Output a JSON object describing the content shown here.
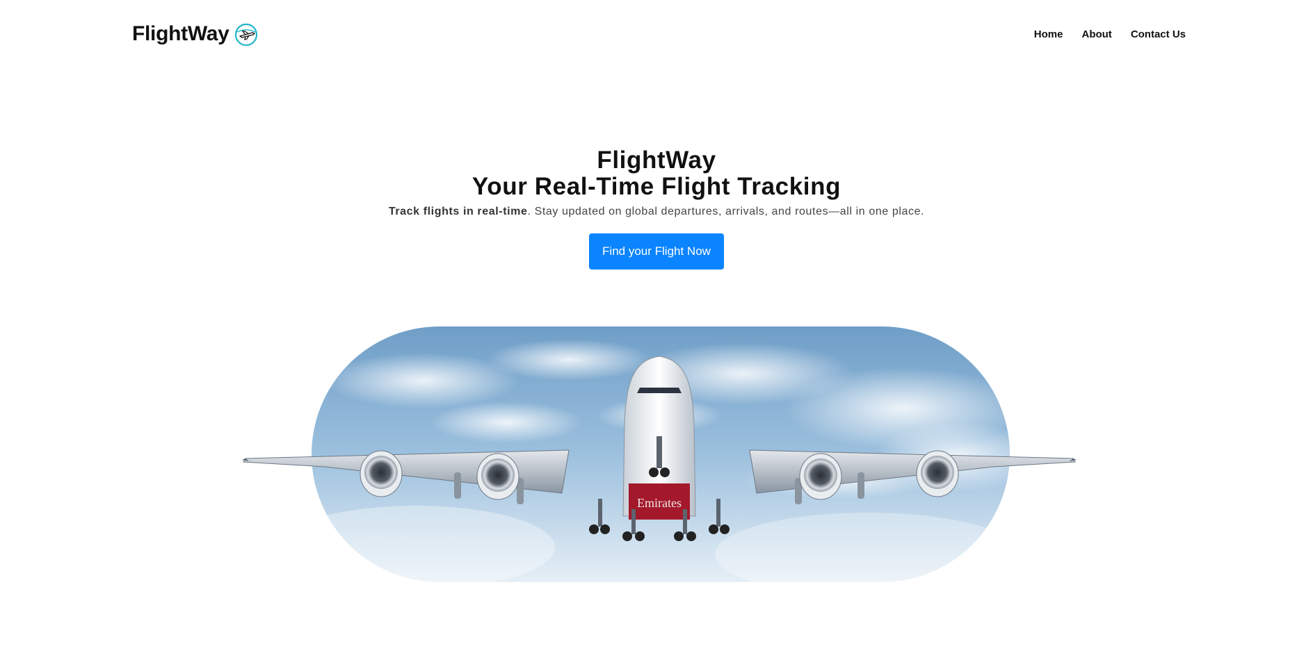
{
  "header": {
    "logo_text": "FlightWay",
    "logo_icon": "plane-globe-icon",
    "nav": [
      {
        "label": "Home"
      },
      {
        "label": "About"
      },
      {
        "label": "Contact Us"
      }
    ]
  },
  "hero": {
    "title_line1": "FlightWay",
    "title_line2": "Your Real-Time Flight Tracking",
    "subtitle_bold": "Track flights in real-time",
    "subtitle_rest": ". Stay updated on global departures, arrivals, and routes—all in one place.",
    "cta_label": "Find your Flight Now"
  },
  "image": {
    "subject": "airliner-landing-photo",
    "tail_text": "Emirates"
  },
  "colors": {
    "accent": "#0a84ff",
    "text": "#111111",
    "muted": "#444444",
    "logo_teal": "#1fb5c9",
    "livery_red": "#a3192b"
  }
}
